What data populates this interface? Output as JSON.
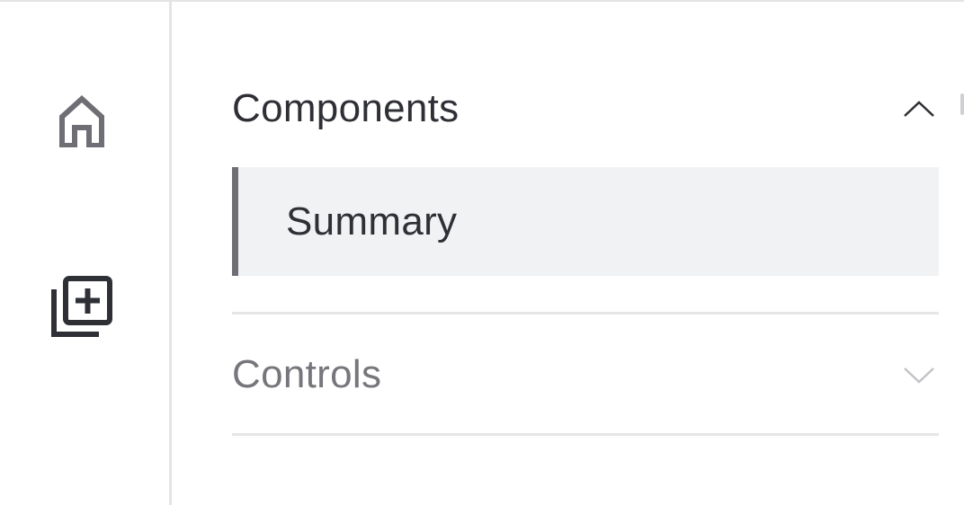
{
  "rail": {
    "items": [
      {
        "icon": "home-icon",
        "label": ""
      },
      {
        "icon": "library-add-icon",
        "label": ""
      }
    ]
  },
  "sections": [
    {
      "title": "Components",
      "expanded": true,
      "items": [
        {
          "label": "Summary",
          "selected": true
        }
      ]
    },
    {
      "title": "Controls",
      "expanded": false,
      "items": []
    }
  ],
  "colors": {
    "accent": "#6e6e74",
    "selected_bg": "#f1f2f4",
    "text_primary": "#2f3036",
    "text_muted": "#76767c",
    "divider": "#e6e6e8"
  }
}
